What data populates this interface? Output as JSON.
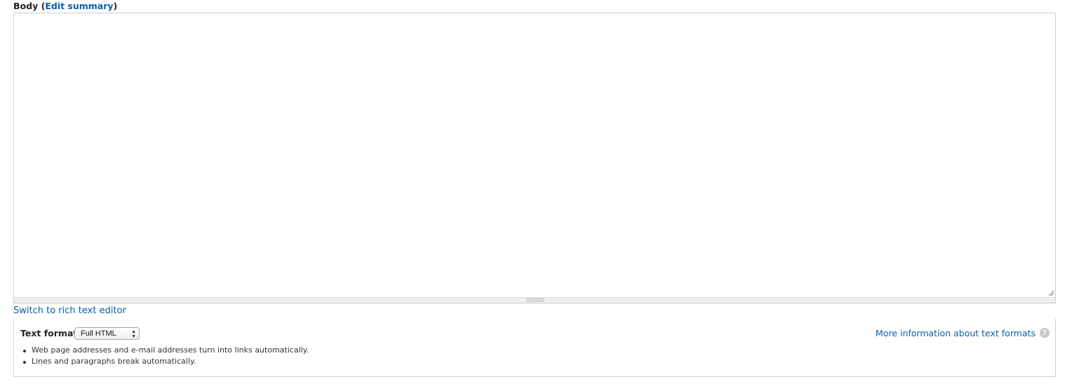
{
  "body_field": {
    "label": "Body",
    "edit_summary_link": "Edit summary",
    "value": ""
  },
  "switch_editor_link": "Switch to rich text editor",
  "text_format": {
    "label": "Text format",
    "selected": "Full HTML",
    "more_info_link": "More information about text formats",
    "help_icon": "question-circle-icon",
    "tips": [
      "Web page addresses and e-mail addresses turn into links automatically.",
      "Lines and paragraphs break automatically."
    ]
  },
  "colors": {
    "link": "#0a5ea8",
    "border": "#cccccc"
  }
}
